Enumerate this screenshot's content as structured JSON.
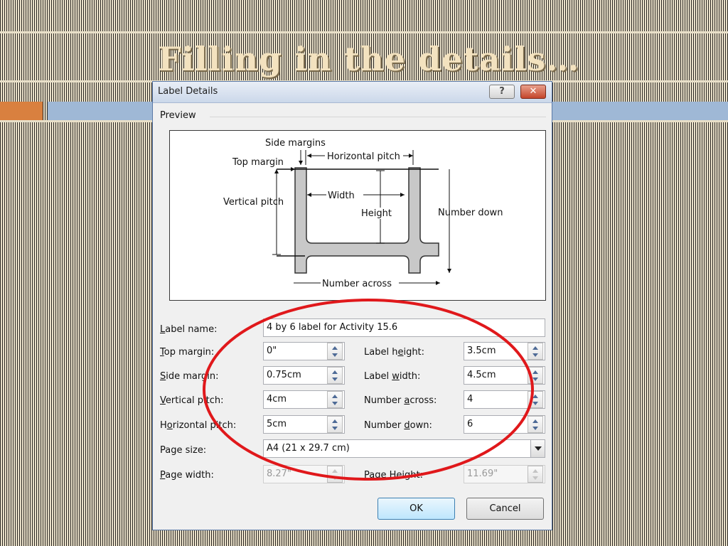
{
  "slide": {
    "title": "Filling in the details…"
  },
  "dialog": {
    "title": "Label Details",
    "help_glyph": "?",
    "close_glyph": "✕",
    "preview_heading": "Preview",
    "diagram": {
      "side_margins": "Side margins",
      "top_margin": "Top margin",
      "horizontal_pitch": "Horizontal pitch",
      "vertical_pitch": "Vertical pitch",
      "width": "Width",
      "height": "Height",
      "number_down": "Number down",
      "number_across": "Number across"
    },
    "label_name": {
      "label_first": "L",
      "label_rest": "abel name:",
      "value": "4 by 6 label for Activity 15.6"
    },
    "top_margin": {
      "label_first": "T",
      "label_rest": "op margin:",
      "value": "0\""
    },
    "side_margin": {
      "label_first": "S",
      "label_rest": "ide margin:",
      "value": "0.75cm"
    },
    "vertical_pitch": {
      "label_first": "V",
      "label_rest": "ertical pitch:",
      "value": "4cm"
    },
    "horizontal_pitch": {
      "label_pre": "H",
      "label_first": "o",
      "label_rest": "rizontal pitch:",
      "value": "5cm"
    },
    "label_height": {
      "label_pre": "Label h",
      "label_first": "e",
      "label_rest": "ight:",
      "value": "3.5cm"
    },
    "label_width": {
      "label_pre": "Label ",
      "label_first": "w",
      "label_rest": "idth:",
      "value": "4.5cm"
    },
    "number_across": {
      "label_pre": "Number ",
      "label_first": "a",
      "label_rest": "cross:",
      "value": "4"
    },
    "number_down": {
      "label_pre": "Number ",
      "label_first": "d",
      "label_rest": "own:",
      "value": "6"
    },
    "page_size": {
      "label": "Page size:",
      "value": "A4 (21 x 29.7 cm)"
    },
    "page_width": {
      "label_first": "P",
      "label_rest": "age width:",
      "value": "8.27\""
    },
    "page_height": {
      "label_pre": "Page ",
      "label_first": "H",
      "label_rest": "eight:",
      "value": "11.69\""
    },
    "ok_label": "OK",
    "cancel_label": "Cancel"
  },
  "colors": {
    "callout_ellipse": "#e0181b",
    "accent_orange": "#d9803f",
    "accent_blue": "#9fb8d6"
  }
}
